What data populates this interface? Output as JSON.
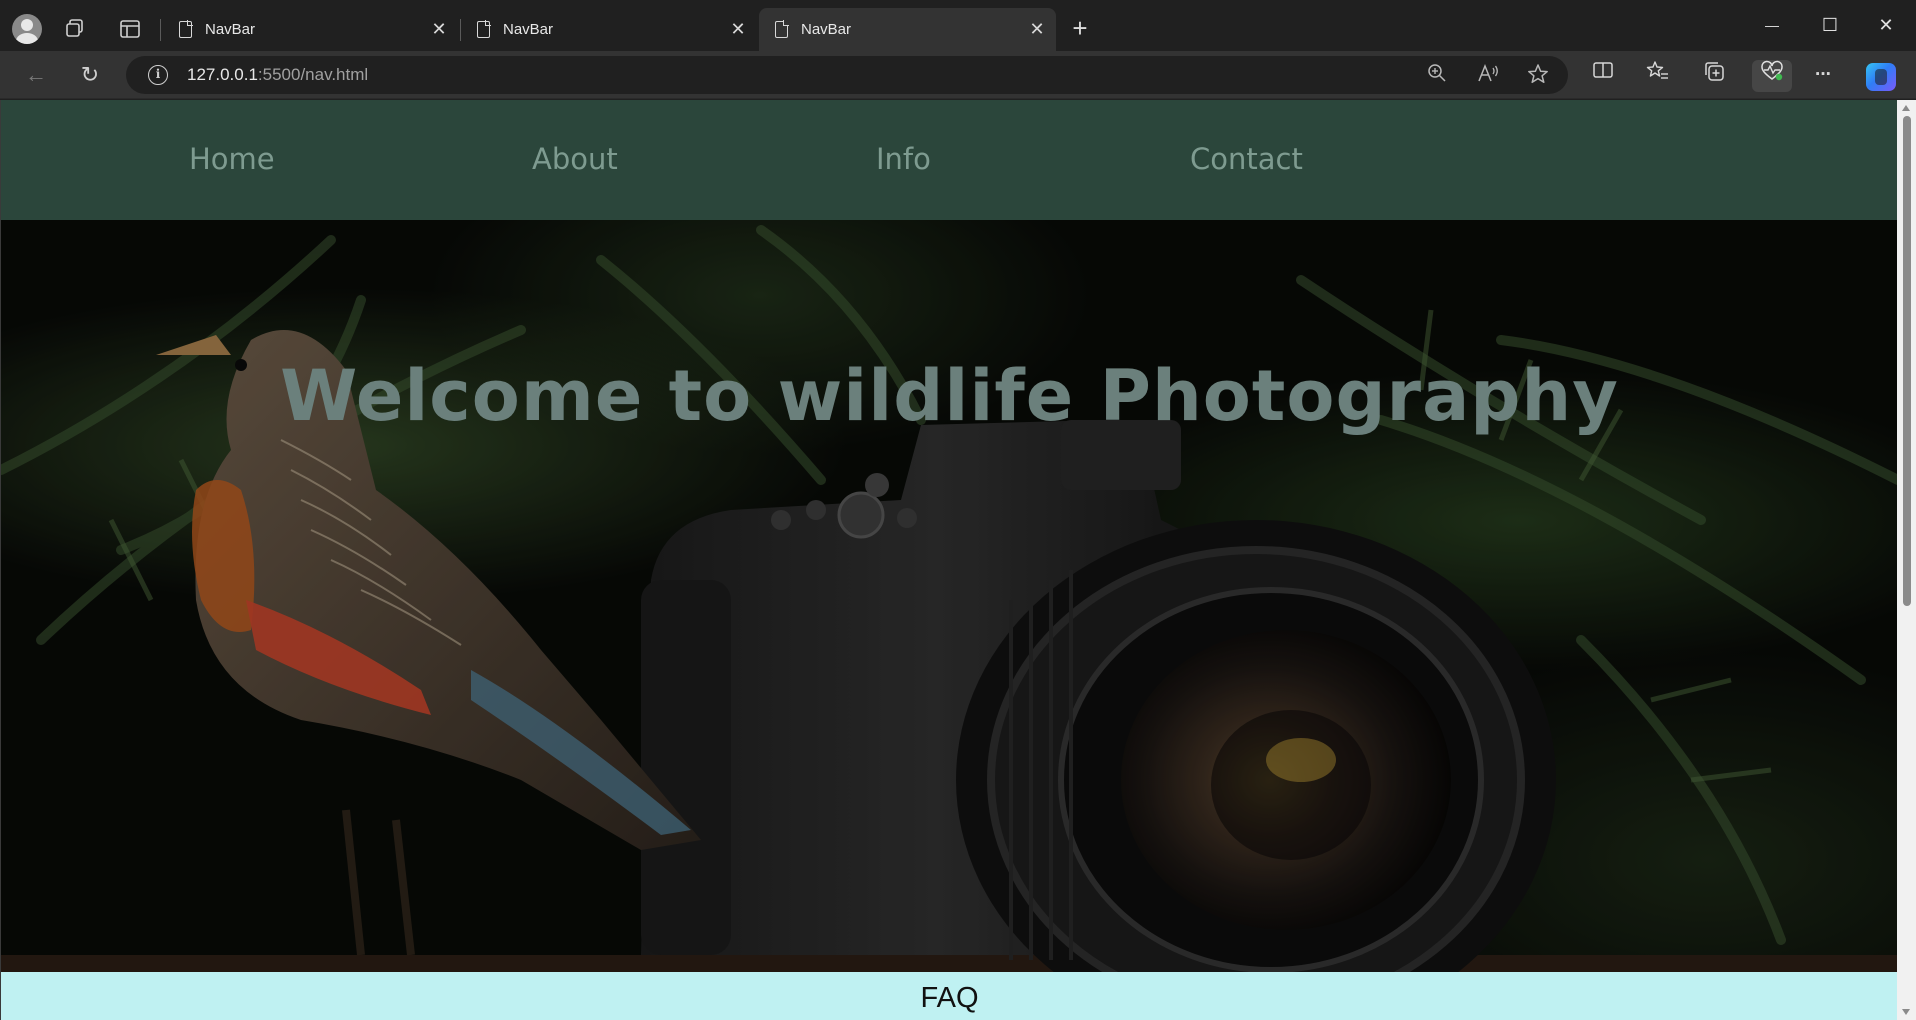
{
  "browser": {
    "tabs": [
      {
        "title": "NavBar",
        "active": false
      },
      {
        "title": "NavBar",
        "active": false
      },
      {
        "title": "NavBar",
        "active": true
      }
    ],
    "url_host": "127.0.0.1",
    "url_rest": ":5500/nav.html",
    "icons": {
      "profile": "profile-avatar-icon",
      "workspaces": "workspaces-icon",
      "tab_actions": "vertical-tabs-icon",
      "tab_page": "page-icon",
      "tab_close": "close-icon",
      "new_tab": "plus-icon",
      "back": "back-arrow-icon",
      "refresh": "refresh-icon",
      "site_info": "info-icon",
      "zoom": "zoom-icon",
      "read_aloud": "read-aloud-icon",
      "favorite": "star-icon",
      "split_screen": "split-screen-icon",
      "favorites": "favorites-icon",
      "collections": "collections-icon",
      "browser_essentials": "heart-pulse-icon",
      "more": "more-icon",
      "copilot": "copilot-icon"
    },
    "glyphs": {
      "close": "✕",
      "new_tab": "+",
      "minimize": "—",
      "maximize": "☐",
      "window_close": "✕",
      "back": "←",
      "refresh": "↻",
      "info": "i",
      "more": "···"
    }
  },
  "site": {
    "nav": [
      "Home",
      "About",
      "Info",
      "Contact"
    ],
    "hero_title": "Welcome to wildlife Photography",
    "faq_label": "FAQ"
  },
  "colors": {
    "nav_bg": "#2b463b",
    "nav_text": "#7e9b90",
    "hero_title": "#6b807c",
    "faq_bg": "#bff1f2"
  }
}
